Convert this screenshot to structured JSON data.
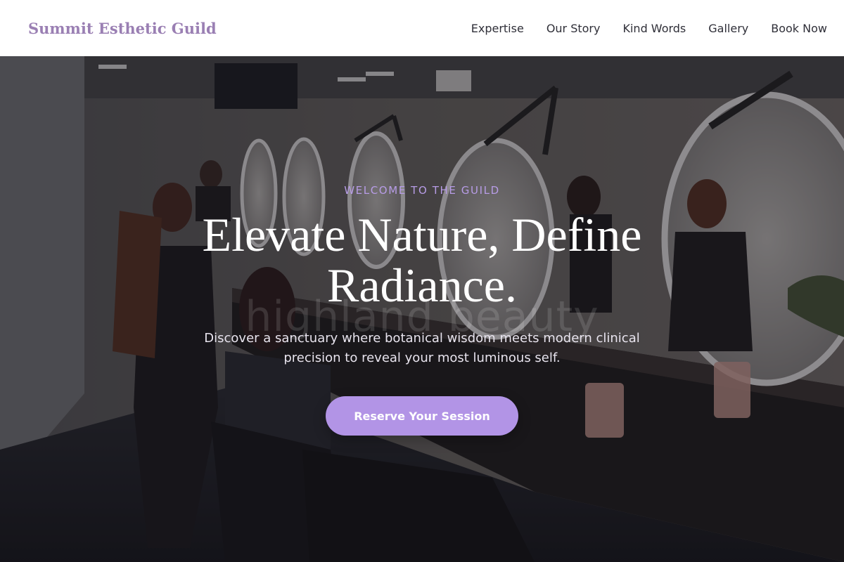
{
  "header": {
    "brand": "Summit Esthetic Guild",
    "nav": [
      "Expertise",
      "Our Story",
      "Kind Words",
      "Gallery",
      "Book Now"
    ]
  },
  "hero": {
    "eyebrow": "WELCOME TO THE GUILD",
    "headline_line1": "Elevate Nature, Define",
    "headline_line2": "Radiance.",
    "ghost_text": "highland beauty",
    "subtext": "Discover a sanctuary where botanical wisdom meets modern clinical precision to reveal your most luminous self.",
    "cta_label": "Reserve Your Session"
  },
  "colors": {
    "brand": "#9a7fb3",
    "accent": "#b294e6",
    "eyebrow": "#b79ce6"
  }
}
